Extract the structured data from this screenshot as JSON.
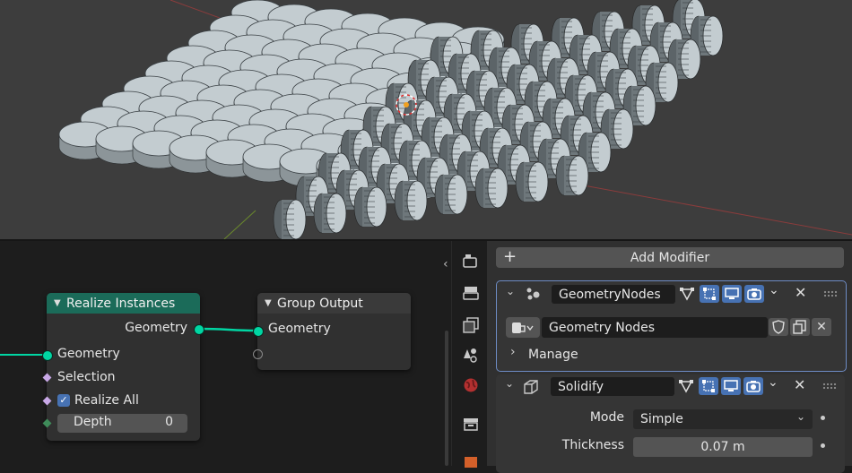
{
  "node_editor": {
    "realize_node": {
      "title": "Realize Instances",
      "output_geometry": "Geometry",
      "input_geometry": "Geometry",
      "input_selection": "Selection",
      "realize_all_label": "Realize All",
      "realize_all_checked": true,
      "depth_label": "Depth",
      "depth_value": "0"
    },
    "group_output_node": {
      "title": "Group Output",
      "input_geometry": "Geometry"
    },
    "colors": {
      "geometry_socket": "#00d6a3",
      "field_socket": "#c8a8e6",
      "int_socket": "#3f8c5a",
      "realize_header": "#1b6b59",
      "group_output_header": "#3a3a3a"
    }
  },
  "properties": {
    "add_modifier_label": "Add Modifier",
    "modifiers": [
      {
        "name": "GeometryNodes",
        "node_group": "Geometry Nodes",
        "manage_label": "Manage",
        "active": true
      },
      {
        "name": "Solidify",
        "mode_label": "Mode",
        "mode_value": "Simple",
        "thickness_label": "Thickness",
        "thickness_value": "0.07 m"
      }
    ]
  },
  "sidebar_tabs": [
    "render-icon",
    "output-icon",
    "view-layer-icon",
    "scene-icon",
    "world-icon",
    "collection-icon",
    "texture-icon"
  ],
  "accent_color": "#4772b3"
}
